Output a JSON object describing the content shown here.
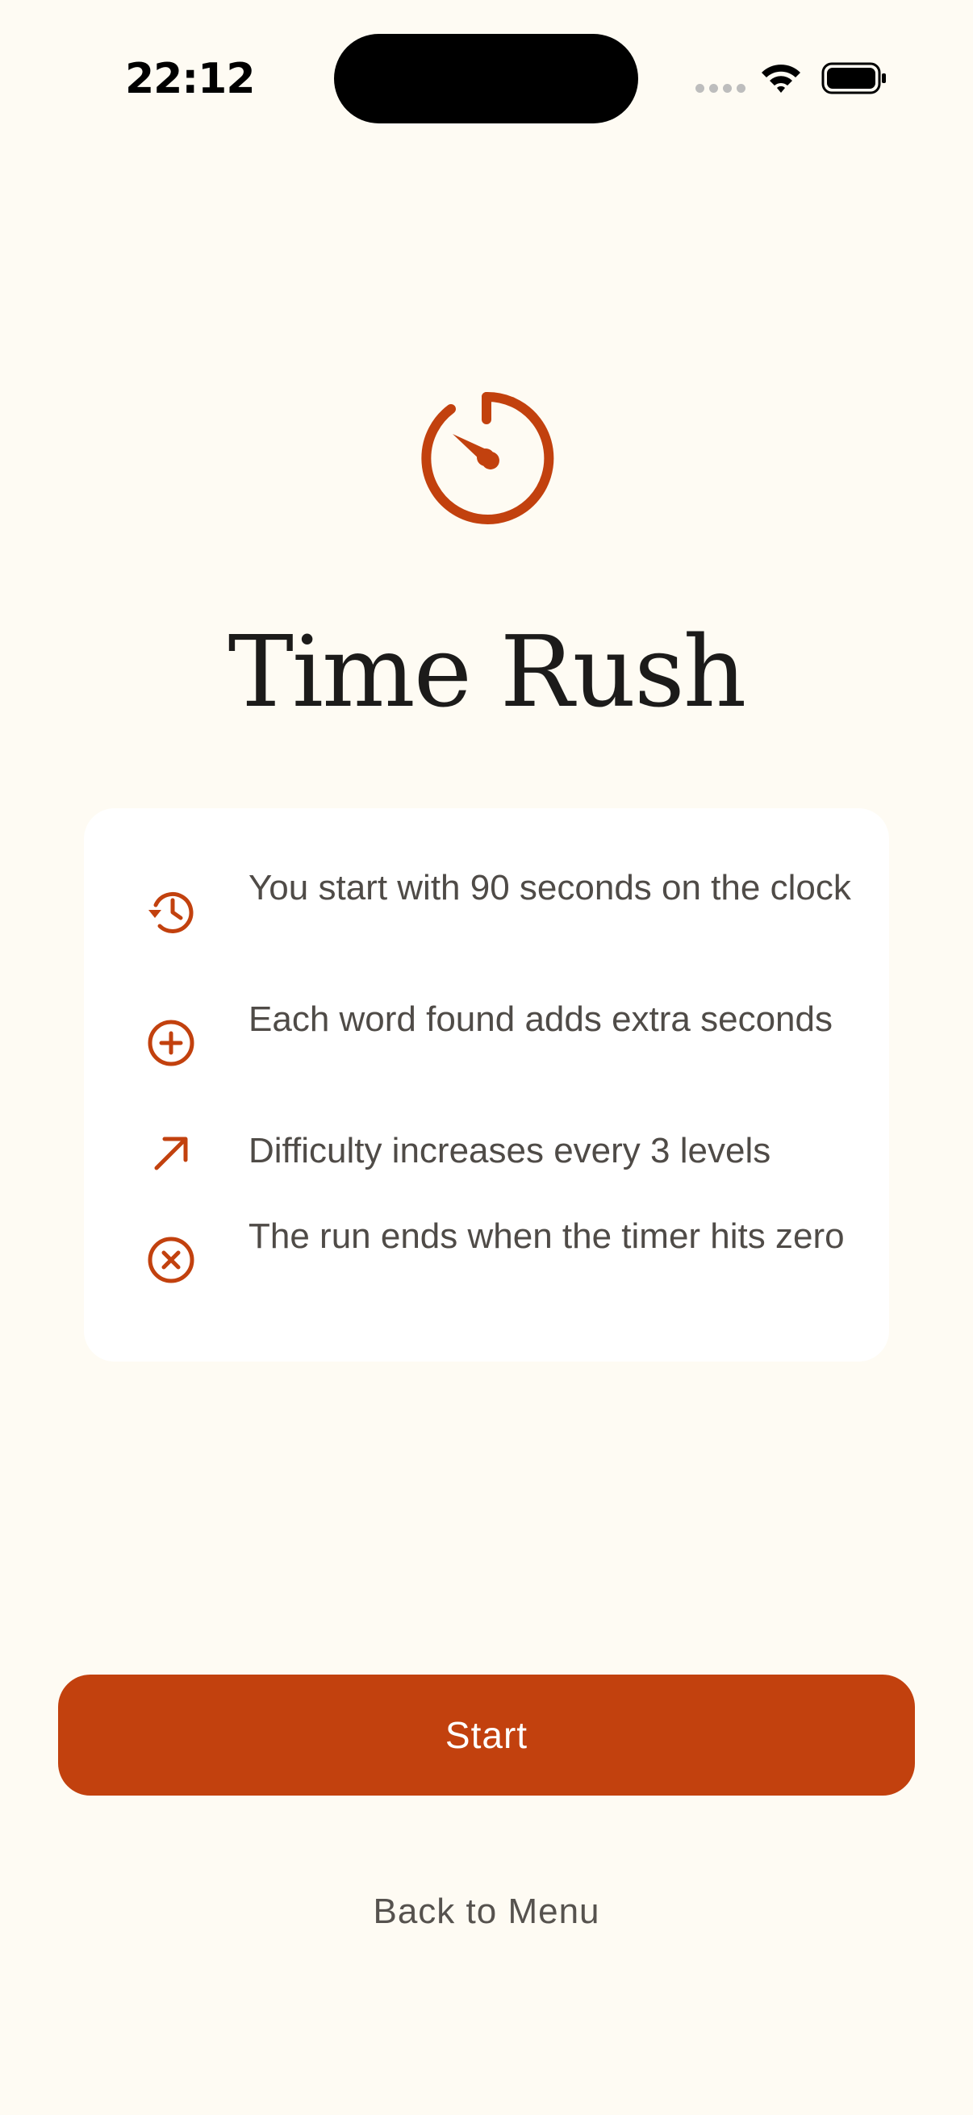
{
  "status_bar": {
    "time": "22:12",
    "signal_icon": "cellular-signal-icon",
    "wifi_icon": "wifi-icon",
    "battery_icon": "battery-icon"
  },
  "hero": {
    "icon": "stopwatch-icon",
    "title": "Time Rush"
  },
  "rules": [
    {
      "icon": "clock-rewind-icon",
      "text": "You start with 90 seconds on the clock"
    },
    {
      "icon": "plus-circle-icon",
      "text": "Each word found adds extra seconds"
    },
    {
      "icon": "arrow-up-right-icon",
      "text": "Difficulty increases every 3 levels"
    },
    {
      "icon": "x-circle-icon",
      "text": "The run ends when the timer hits zero"
    }
  ],
  "actions": {
    "start_label": "Start",
    "back_label": "Back to Menu"
  },
  "colors": {
    "background": "#FEFBF3",
    "accent": "#C2410E",
    "card": "#FFFFFF",
    "title": "#1C1B1A",
    "body_text": "#4F4B47"
  }
}
